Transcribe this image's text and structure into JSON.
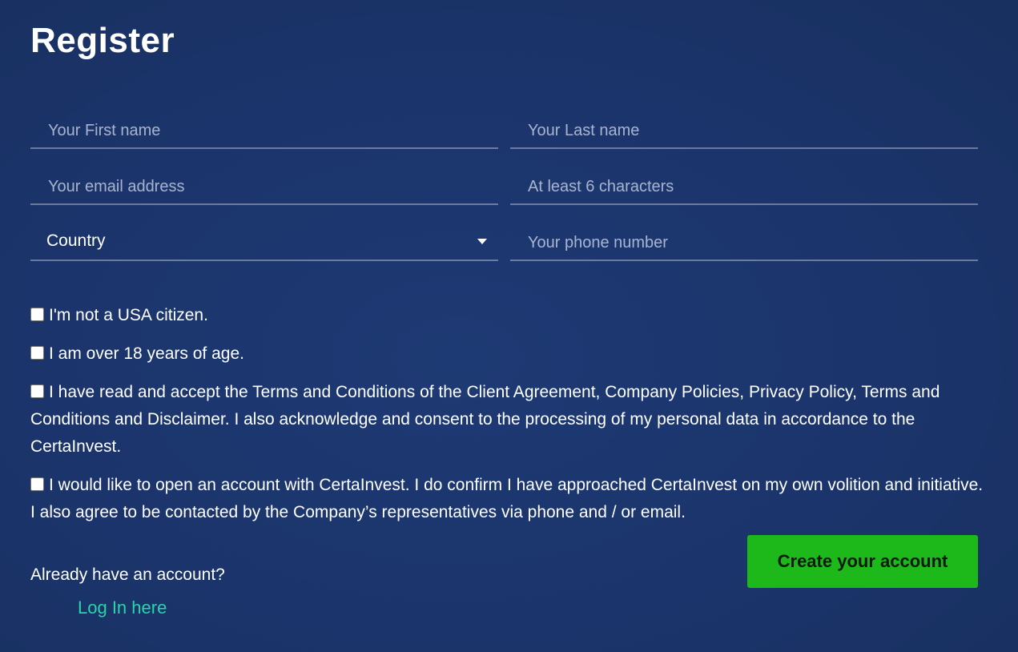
{
  "form": {
    "title": "Register",
    "fields": {
      "first_name": {
        "placeholder": "Your First name"
      },
      "last_name": {
        "placeholder": "Your Last name"
      },
      "email": {
        "placeholder": "Your email address"
      },
      "password": {
        "placeholder": "At least 6 characters"
      },
      "country": {
        "selected": "Country"
      },
      "phone": {
        "placeholder": "Your phone number"
      }
    },
    "checks": {
      "not_usa": "I'm not a USA citizen.",
      "over_18": "I am over 18 years of age.",
      "terms": "I have read and accept the Terms and Conditions of the Client Agreement, Company Policies, Privacy Policy, Terms and Conditions and Disclaimer. I also acknowledge and consent to the processing of my personal data in accordance to the CertaInvest.",
      "volition": "I would like to open an account with CertaInvest. I do confirm I have approached CertaInvest on my own volition and initiative. I also agree to be contacted by the Company’s representatives via phone and / or email."
    },
    "footer": {
      "already": "Already have an account?",
      "login": "Log In here",
      "create": "Create your account"
    }
  },
  "colors": {
    "background": "#1b346b",
    "button": "#1db91b",
    "link": "#2ad4a6"
  }
}
